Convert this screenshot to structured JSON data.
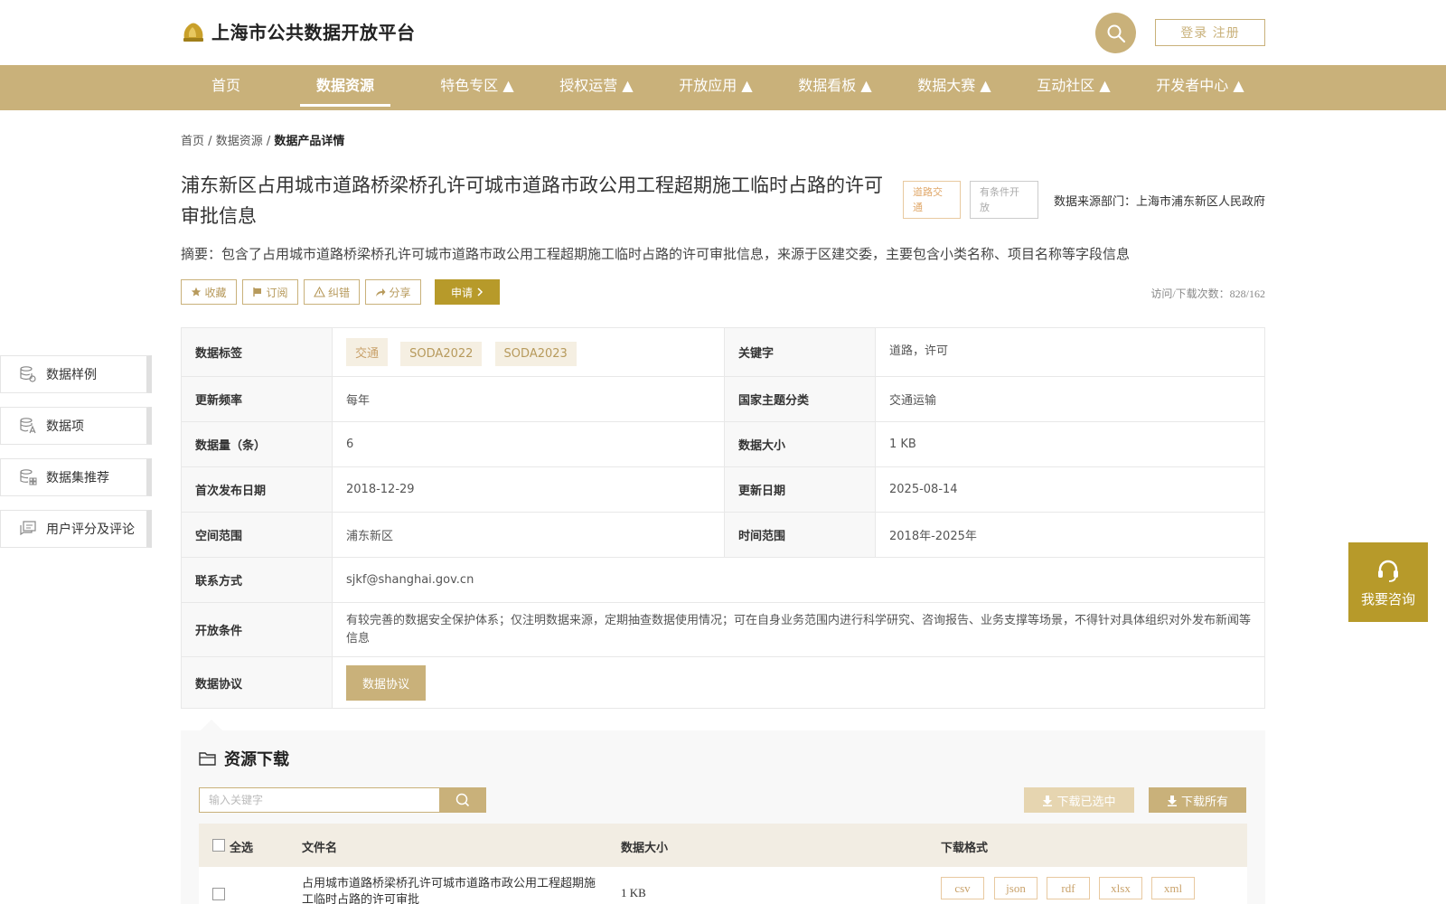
{
  "header": {
    "site_title": "上海市公共数据开放平台",
    "login_label": "登录 注册"
  },
  "nav": {
    "items": [
      "首页",
      "数据资源",
      "特色专区 ▲",
      "授权运营 ▲",
      "开放应用 ▲",
      "数据看板 ▲",
      "数据大赛 ▲",
      "互动社区 ▲",
      "开发者中心 ▲"
    ],
    "active": "数据资源"
  },
  "breadcrumb": {
    "home": "首页",
    "sep": "/",
    "section": "数据资源",
    "current": "数据产品详情"
  },
  "product": {
    "title": "浦东新区占用城市道路桥梁桥孔许可城市道路市政公用工程超期施工临时占路的许可审批信息",
    "tag_category": "道路交通",
    "tag_open": "有条件开放",
    "source_dept": "数据来源部门：上海市浦东新区人民政府",
    "summary": "摘要：包含了占用城市道路桥梁桥孔许可城市道路市政公用工程超期施工临时占路的许可审批信息，来源于区建交委，主要包含小类名称、项目名称等字段信息",
    "visit_count": "访问/下载次数：828/162"
  },
  "actions": {
    "favorite": "收藏",
    "subscribe": "订阅",
    "correct": "纠错",
    "share": "分享",
    "apply": "申请"
  },
  "side_menu": {
    "items": [
      "数据样例",
      "数据项",
      "数据集推荐",
      "用户评分及评论"
    ]
  },
  "info": {
    "tags_label": "数据标签",
    "tags": [
      "交通",
      "SODA2022",
      "SODA2023"
    ],
    "keywords_label": "关键字",
    "keywords": "道路，许可",
    "freq_label": "更新频率",
    "freq": "每年",
    "theme_label": "国家主题分类",
    "theme": "交通运输",
    "count_label": "数据量（条）",
    "count": "6",
    "size_label": "数据大小",
    "size": "1 KB",
    "first_pub_label": "首次发布日期",
    "first_pub": "2018-12-29",
    "update_label": "更新日期",
    "update": "2025-08-14",
    "space_label": "空间范围",
    "space": "浦东新区",
    "time_label": "时间范围",
    "time": "2018年-2025年",
    "contact_label": "联系方式",
    "contact": "sjkf@shanghai.gov.cn",
    "condition_label": "开放条件",
    "condition": "有较完善的数据安全保护体系；仅注明数据来源，定期抽查数据使用情况；可在自身业务范围内进行科学研究、咨询报告、业务支撑等场景，不得针对具体组织对外发布新闻等信息",
    "protocol_label": "数据协议",
    "protocol_btn": "数据协议"
  },
  "resources": {
    "title": "资源下载",
    "search_placeholder": "输入关键字",
    "download_selected": "下载已选中",
    "download_all": "下载所有",
    "columns": [
      "全选",
      "文件名",
      "数据大小",
      "下载格式"
    ],
    "rows": [
      {
        "name": "占用城市道路桥梁桥孔许可城市道路市政公用工程超期施工临时占路的许可审批",
        "size": "1 KB",
        "formats": [
          "csv",
          "json",
          "rdf",
          "xlsx",
          "xml"
        ]
      }
    ]
  },
  "consult": {
    "label": "我要咨询"
  },
  "colors": {
    "brand": "#c9b17a",
    "accent_dark": "#b79a2a"
  }
}
